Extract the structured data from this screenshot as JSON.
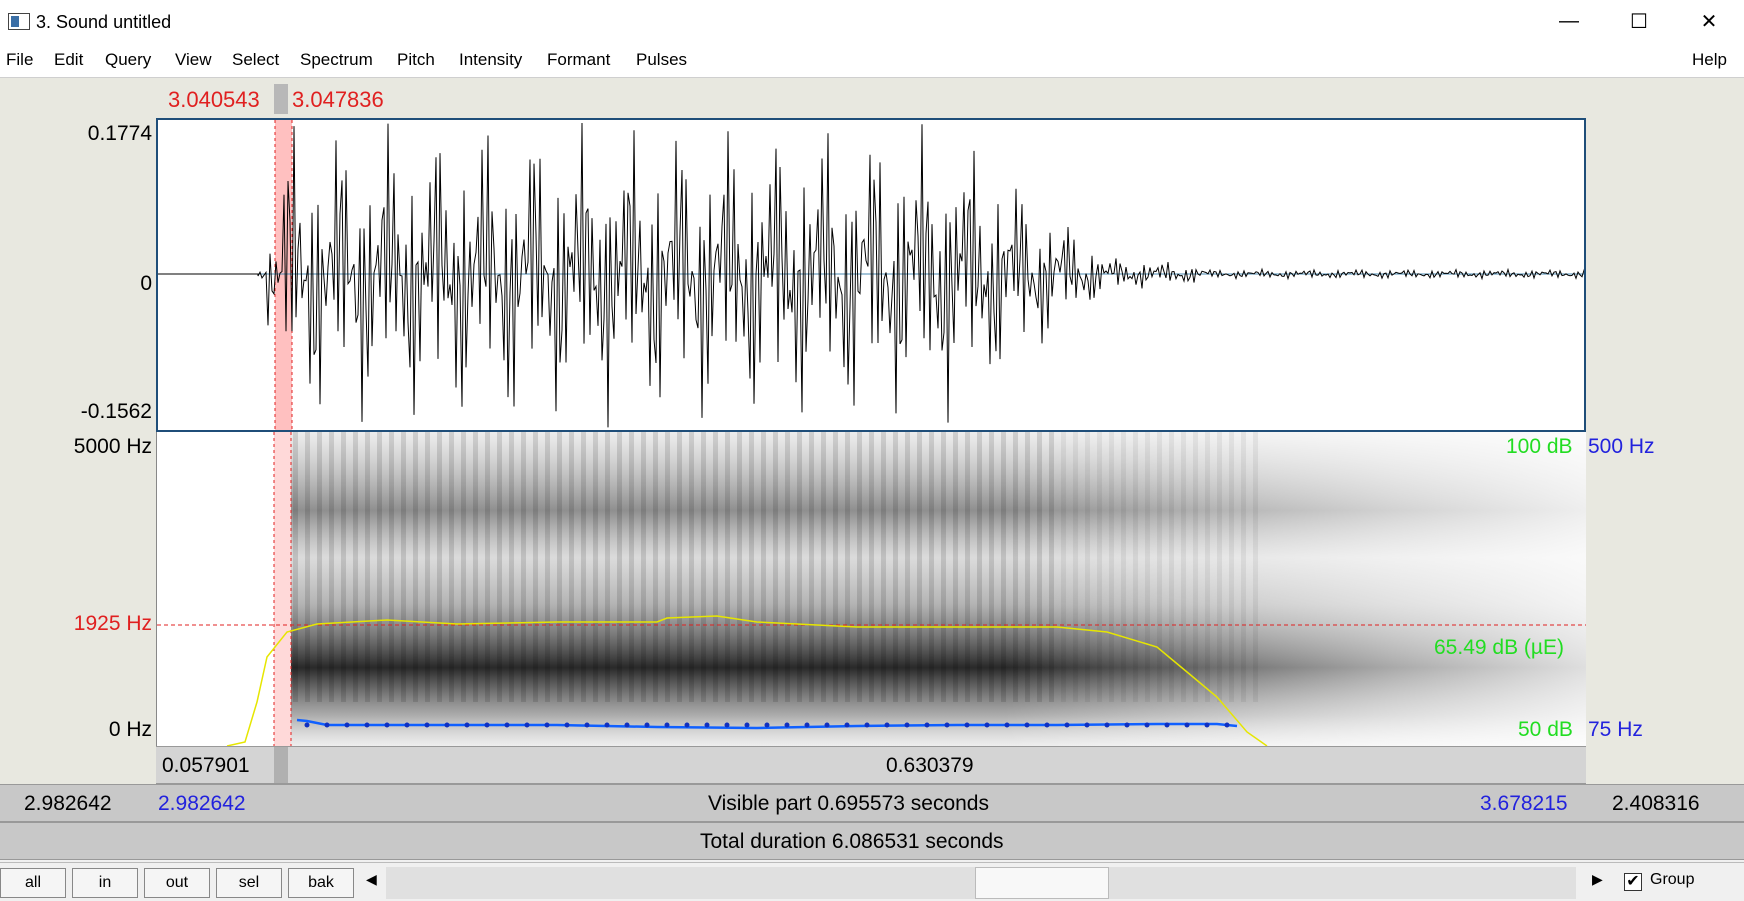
{
  "window": {
    "title": "3. Sound untitled",
    "minimize_glyph": "—",
    "maximize_glyph": "☐",
    "close_glyph": "✕"
  },
  "menu": {
    "items": [
      "File",
      "Edit",
      "Query",
      "View",
      "Select",
      "Spectrum",
      "Pitch",
      "Intensity",
      "Formant",
      "Pulses"
    ],
    "help": "Help"
  },
  "selection": {
    "start": "3.040543",
    "end": "3.047836"
  },
  "waveform": {
    "max_label": "0.1774",
    "zero_label": "0",
    "min_label": "-0.1562"
  },
  "spectrogram": {
    "top_freq": "5000 Hz",
    "cursor_freq": "1925 Hz",
    "bottom_freq": "0 Hz",
    "intensity_top": "100 dB",
    "intensity_cursor": "65.49 dB (µE)",
    "intensity_bottom": "50 dB",
    "pitch_top": "500 Hz",
    "pitch_bottom": "75 Hz",
    "colors": {
      "intensity": "#22dd22",
      "pitch": "#2222dd",
      "cursor": "#e02020",
      "intensity_curve": "#e6e600",
      "pitch_curve": "#1060ff"
    }
  },
  "durations": {
    "left_segment": "0.057901",
    "right_segment": "0.630379",
    "left_total": "2.982642",
    "visible_start": "2.982642",
    "visible_part": "Visible part 0.695573 seconds",
    "visible_end": "3.678215",
    "right_total": "2.408316",
    "total": "Total duration 6.086531 seconds"
  },
  "bottom": {
    "buttons": [
      "all",
      "in",
      "out",
      "sel",
      "bak"
    ],
    "scroll_left": "◀",
    "scroll_right": "▶",
    "group_label": "Group",
    "group_checked": "✔"
  }
}
